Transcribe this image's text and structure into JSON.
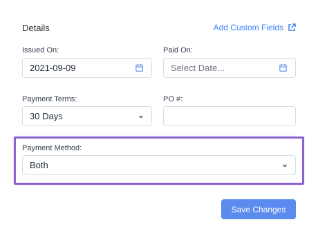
{
  "header": {
    "title": "Details",
    "add_custom_fields_label": "Add Custom Fields",
    "add_custom_fields_icon": "external-link-icon"
  },
  "form": {
    "issued_on": {
      "label": "Issued On:",
      "value": "2021-09-09",
      "icon": "calendar-icon"
    },
    "paid_on": {
      "label": "Paid On:",
      "placeholder": "Select Date...",
      "icon": "calendar-icon"
    },
    "payment_terms": {
      "label": "Payment Terms:",
      "value": "30 Days",
      "icon": "chevron-down-icon"
    },
    "po_number": {
      "label": "PO #:",
      "value": ""
    },
    "payment_method": {
      "label": "Payment Method:",
      "value": "Both",
      "icon": "chevron-down-icon"
    }
  },
  "footer": {
    "save_label": "Save Changes"
  },
  "colors": {
    "accent": "#5b8bef",
    "link": "#3b82f6",
    "highlight": "#8a63d2"
  }
}
